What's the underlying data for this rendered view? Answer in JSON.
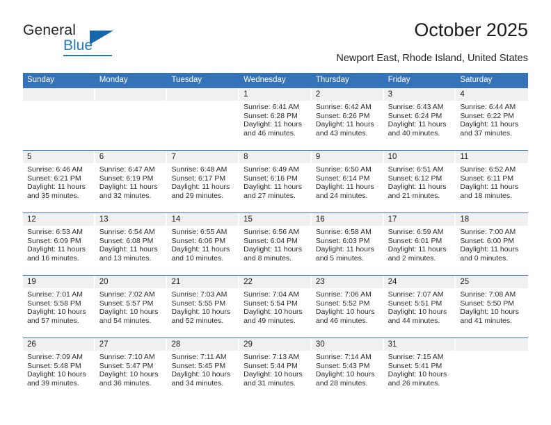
{
  "brand": {
    "name_part1": "General",
    "name_part2": "Blue",
    "accent_color": "#1f7ac4",
    "triangle_color": "#1566ad"
  },
  "header": {
    "title": "October 2025",
    "subtitle": "Newport East, Rhode Island, United States"
  },
  "calendar": {
    "header_bg": "#3573b9",
    "weekdays": [
      "Sunday",
      "Monday",
      "Tuesday",
      "Wednesday",
      "Thursday",
      "Friday",
      "Saturday"
    ],
    "weeks": [
      [
        {
          "day": "",
          "sunrise": "",
          "sunset": "",
          "daylight": ""
        },
        {
          "day": "",
          "sunrise": "",
          "sunset": "",
          "daylight": ""
        },
        {
          "day": "",
          "sunrise": "",
          "sunset": "",
          "daylight": ""
        },
        {
          "day": "1",
          "sunrise": "Sunrise: 6:41 AM",
          "sunset": "Sunset: 6:28 PM",
          "daylight": "Daylight: 11 hours and 46 minutes."
        },
        {
          "day": "2",
          "sunrise": "Sunrise: 6:42 AM",
          "sunset": "Sunset: 6:26 PM",
          "daylight": "Daylight: 11 hours and 43 minutes."
        },
        {
          "day": "3",
          "sunrise": "Sunrise: 6:43 AM",
          "sunset": "Sunset: 6:24 PM",
          "daylight": "Daylight: 11 hours and 40 minutes."
        },
        {
          "day": "4",
          "sunrise": "Sunrise: 6:44 AM",
          "sunset": "Sunset: 6:22 PM",
          "daylight": "Daylight: 11 hours and 37 minutes."
        }
      ],
      [
        {
          "day": "5",
          "sunrise": "Sunrise: 6:46 AM",
          "sunset": "Sunset: 6:21 PM",
          "daylight": "Daylight: 11 hours and 35 minutes."
        },
        {
          "day": "6",
          "sunrise": "Sunrise: 6:47 AM",
          "sunset": "Sunset: 6:19 PM",
          "daylight": "Daylight: 11 hours and 32 minutes."
        },
        {
          "day": "7",
          "sunrise": "Sunrise: 6:48 AM",
          "sunset": "Sunset: 6:17 PM",
          "daylight": "Daylight: 11 hours and 29 minutes."
        },
        {
          "day": "8",
          "sunrise": "Sunrise: 6:49 AM",
          "sunset": "Sunset: 6:16 PM",
          "daylight": "Daylight: 11 hours and 27 minutes."
        },
        {
          "day": "9",
          "sunrise": "Sunrise: 6:50 AM",
          "sunset": "Sunset: 6:14 PM",
          "daylight": "Daylight: 11 hours and 24 minutes."
        },
        {
          "day": "10",
          "sunrise": "Sunrise: 6:51 AM",
          "sunset": "Sunset: 6:12 PM",
          "daylight": "Daylight: 11 hours and 21 minutes."
        },
        {
          "day": "11",
          "sunrise": "Sunrise: 6:52 AM",
          "sunset": "Sunset: 6:11 PM",
          "daylight": "Daylight: 11 hours and 18 minutes."
        }
      ],
      [
        {
          "day": "12",
          "sunrise": "Sunrise: 6:53 AM",
          "sunset": "Sunset: 6:09 PM",
          "daylight": "Daylight: 11 hours and 16 minutes."
        },
        {
          "day": "13",
          "sunrise": "Sunrise: 6:54 AM",
          "sunset": "Sunset: 6:08 PM",
          "daylight": "Daylight: 11 hours and 13 minutes."
        },
        {
          "day": "14",
          "sunrise": "Sunrise: 6:55 AM",
          "sunset": "Sunset: 6:06 PM",
          "daylight": "Daylight: 11 hours and 10 minutes."
        },
        {
          "day": "15",
          "sunrise": "Sunrise: 6:56 AM",
          "sunset": "Sunset: 6:04 PM",
          "daylight": "Daylight: 11 hours and 8 minutes."
        },
        {
          "day": "16",
          "sunrise": "Sunrise: 6:58 AM",
          "sunset": "Sunset: 6:03 PM",
          "daylight": "Daylight: 11 hours and 5 minutes."
        },
        {
          "day": "17",
          "sunrise": "Sunrise: 6:59 AM",
          "sunset": "Sunset: 6:01 PM",
          "daylight": "Daylight: 11 hours and 2 minutes."
        },
        {
          "day": "18",
          "sunrise": "Sunrise: 7:00 AM",
          "sunset": "Sunset: 6:00 PM",
          "daylight": "Daylight: 11 hours and 0 minutes."
        }
      ],
      [
        {
          "day": "19",
          "sunrise": "Sunrise: 7:01 AM",
          "sunset": "Sunset: 5:58 PM",
          "daylight": "Daylight: 10 hours and 57 minutes."
        },
        {
          "day": "20",
          "sunrise": "Sunrise: 7:02 AM",
          "sunset": "Sunset: 5:57 PM",
          "daylight": "Daylight: 10 hours and 54 minutes."
        },
        {
          "day": "21",
          "sunrise": "Sunrise: 7:03 AM",
          "sunset": "Sunset: 5:55 PM",
          "daylight": "Daylight: 10 hours and 52 minutes."
        },
        {
          "day": "22",
          "sunrise": "Sunrise: 7:04 AM",
          "sunset": "Sunset: 5:54 PM",
          "daylight": "Daylight: 10 hours and 49 minutes."
        },
        {
          "day": "23",
          "sunrise": "Sunrise: 7:06 AM",
          "sunset": "Sunset: 5:52 PM",
          "daylight": "Daylight: 10 hours and 46 minutes."
        },
        {
          "day": "24",
          "sunrise": "Sunrise: 7:07 AM",
          "sunset": "Sunset: 5:51 PM",
          "daylight": "Daylight: 10 hours and 44 minutes."
        },
        {
          "day": "25",
          "sunrise": "Sunrise: 7:08 AM",
          "sunset": "Sunset: 5:50 PM",
          "daylight": "Daylight: 10 hours and 41 minutes."
        }
      ],
      [
        {
          "day": "26",
          "sunrise": "Sunrise: 7:09 AM",
          "sunset": "Sunset: 5:48 PM",
          "daylight": "Daylight: 10 hours and 39 minutes."
        },
        {
          "day": "27",
          "sunrise": "Sunrise: 7:10 AM",
          "sunset": "Sunset: 5:47 PM",
          "daylight": "Daylight: 10 hours and 36 minutes."
        },
        {
          "day": "28",
          "sunrise": "Sunrise: 7:11 AM",
          "sunset": "Sunset: 5:45 PM",
          "daylight": "Daylight: 10 hours and 34 minutes."
        },
        {
          "day": "29",
          "sunrise": "Sunrise: 7:13 AM",
          "sunset": "Sunset: 5:44 PM",
          "daylight": "Daylight: 10 hours and 31 minutes."
        },
        {
          "day": "30",
          "sunrise": "Sunrise: 7:14 AM",
          "sunset": "Sunset: 5:43 PM",
          "daylight": "Daylight: 10 hours and 28 minutes."
        },
        {
          "day": "31",
          "sunrise": "Sunrise: 7:15 AM",
          "sunset": "Sunset: 5:41 PM",
          "daylight": "Daylight: 10 hours and 26 minutes."
        },
        {
          "day": "",
          "sunrise": "",
          "sunset": "",
          "daylight": ""
        }
      ]
    ]
  }
}
